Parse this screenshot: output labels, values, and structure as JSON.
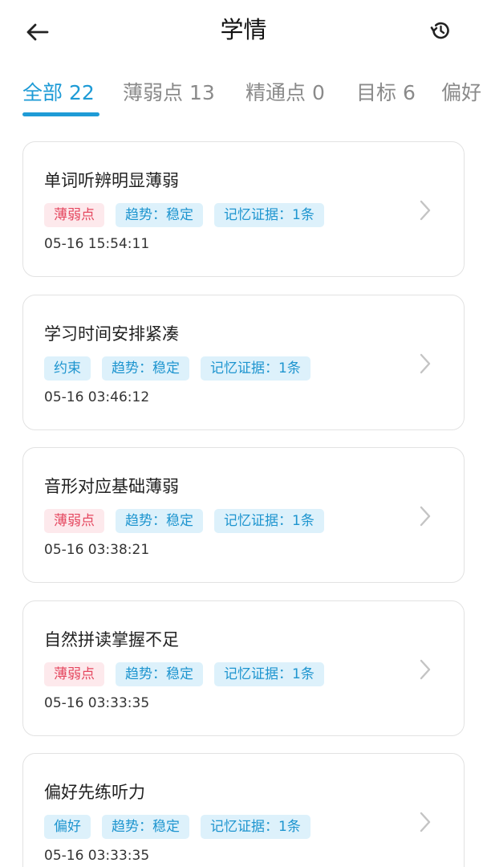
{
  "header": {
    "title": "学情",
    "back_icon": "arrow-left-icon",
    "history_icon": "history-icon"
  },
  "tabs": [
    {
      "label": "全部 22",
      "active": true
    },
    {
      "label": "薄弱点 13",
      "active": false
    },
    {
      "label": "精通点 0",
      "active": false
    },
    {
      "label": "目标 6",
      "active": false
    },
    {
      "label": "偏好",
      "active": false
    }
  ],
  "colors": {
    "accent": "#1e9bd6",
    "tag_red_bg": "#fde9ec",
    "tag_red_text": "#e5475f",
    "tag_blue_bg": "#ddf1fb",
    "tag_blue_text": "#1e95cf"
  },
  "cards": [
    {
      "title": "单词听辨明显薄弱",
      "type_tag": "薄弱点",
      "trend_tag": "趋势：稳定",
      "evidence_tag": "记忆证据：1条",
      "time": "05-16 15:54:11"
    },
    {
      "title": "学习时间安排紧凑",
      "type_tag": "约束",
      "trend_tag": "趋势：稳定",
      "evidence_tag": "记忆证据：1条",
      "time": "05-16 03:46:12"
    },
    {
      "title": "音形对应基础薄弱",
      "type_tag": "薄弱点",
      "trend_tag": "趋势：稳定",
      "evidence_tag": "记忆证据：1条",
      "time": "05-16 03:38:21"
    },
    {
      "title": "自然拼读掌握不足",
      "type_tag": "薄弱点",
      "trend_tag": "趋势：稳定",
      "evidence_tag": "记忆证据：1条",
      "time": "05-16 03:33:35"
    },
    {
      "title": "偏好先练听力",
      "type_tag": "偏好",
      "trend_tag": "趋势：稳定",
      "evidence_tag": "记忆证据：1条",
      "time": "05-16 03:33:35"
    }
  ]
}
